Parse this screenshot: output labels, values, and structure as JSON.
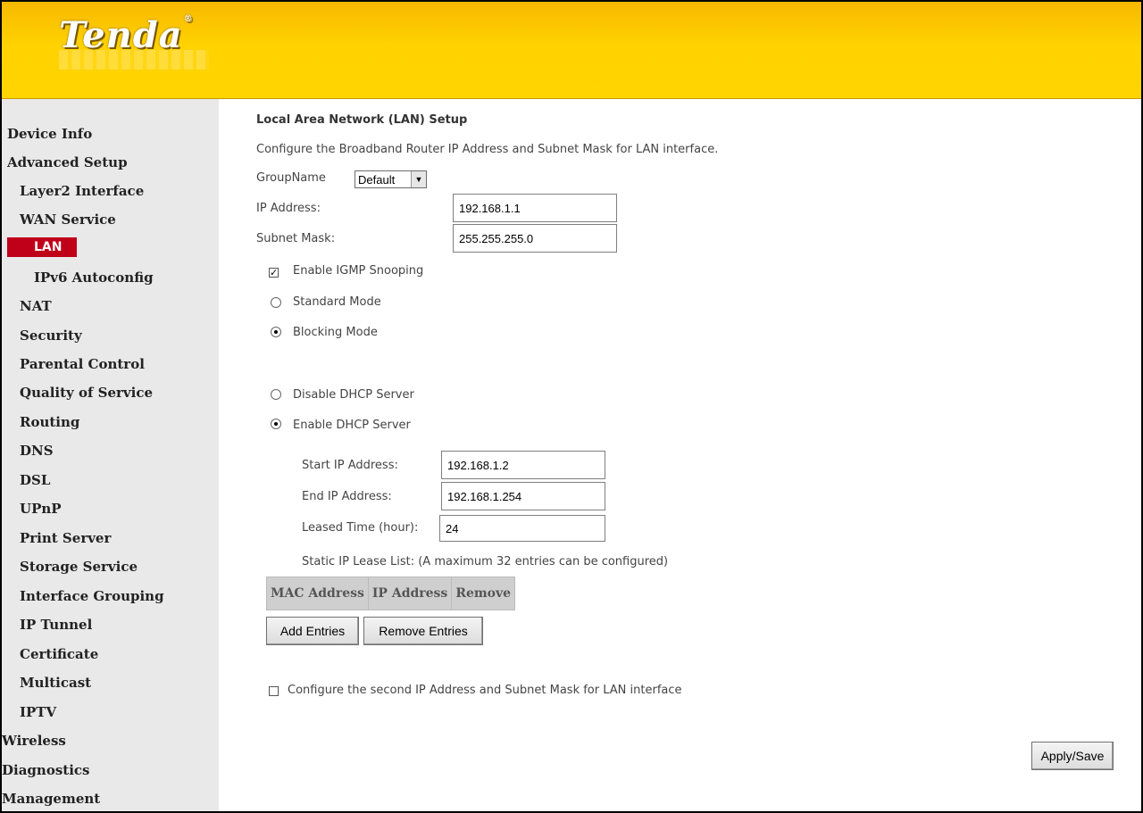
{
  "brand": {
    "logo_text": "Tenda",
    "registered_mark": "®"
  },
  "sidebar": {
    "items": [
      {
        "label": "Device Info"
      },
      {
        "label": "Advanced Setup"
      },
      {
        "label": "Layer2 Interface"
      },
      {
        "label": "WAN Service"
      },
      {
        "label": "LAN"
      },
      {
        "label": "IPv6 Autoconfig"
      },
      {
        "label": "NAT"
      },
      {
        "label": "Security"
      },
      {
        "label": "Parental Control"
      },
      {
        "label": "Quality of Service"
      },
      {
        "label": "Routing"
      },
      {
        "label": "DNS"
      },
      {
        "label": "DSL"
      },
      {
        "label": "UPnP"
      },
      {
        "label": "Print Server"
      },
      {
        "label": "Storage Service"
      },
      {
        "label": "Interface Grouping"
      },
      {
        "label": "IP Tunnel"
      },
      {
        "label": "Certificate"
      },
      {
        "label": "Multicast"
      },
      {
        "label": "IPTV"
      },
      {
        "label": "Wireless"
      },
      {
        "label": "Diagnostics"
      },
      {
        "label": "Management"
      }
    ],
    "active": "LAN",
    "active_color": "#c00018"
  },
  "main": {
    "title": "Local Area Network (LAN) Setup",
    "description": "Configure the Broadband Router IP Address and Subnet Mask for LAN interface.",
    "group_name": {
      "label": "GroupName",
      "value": "Default"
    },
    "ip_address": {
      "label": "IP Address:",
      "value": "192.168.1.1"
    },
    "subnet_mask": {
      "label": "Subnet Mask:",
      "value": "255.255.255.0"
    },
    "igmp": {
      "label": "Enable IGMP Snooping",
      "checked": true
    },
    "standard_mode": {
      "label": "Standard Mode",
      "selected": false
    },
    "blocking_mode": {
      "label": "Blocking Mode",
      "selected": true
    },
    "disable_dhcp": {
      "label": "Disable DHCP Server",
      "selected": false
    },
    "enable_dhcp": {
      "label": "Enable DHCP Server",
      "selected": true
    },
    "start_ip": {
      "label": "Start IP Address:",
      "value": "192.168.1.2"
    },
    "end_ip": {
      "label": "End IP Address:",
      "value": "192.168.1.254"
    },
    "lease_time": {
      "label": "Leased Time (hour):",
      "value": "24"
    },
    "static_lease_note": "Static IP Lease List: (A maximum 32 entries can be configured)",
    "lease_table": {
      "columns": [
        "MAC Address",
        "IP Address",
        "Remove"
      ]
    },
    "add_entries_label": "Add Entries",
    "remove_entries_label": "Remove Entries",
    "second_ip": {
      "label": "Configure the second IP Address and Subnet Mask for LAN interface",
      "checked": false
    },
    "apply_save_label": "Apply/Save"
  },
  "colors": {
    "header_yellow": "#ffd200",
    "sidebar_bg": "#e9e9e9",
    "active_red": "#c00018"
  }
}
